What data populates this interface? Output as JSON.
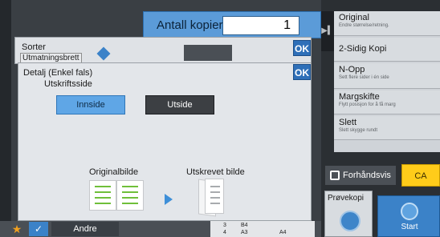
{
  "copies": {
    "label": "Antall kopier",
    "value": "1"
  },
  "right_panel": {
    "items": [
      {
        "title": "Original",
        "subtitle": "Endre størrelse/retning."
      },
      {
        "title": "2-Sidig Kopi",
        "subtitle": ""
      },
      {
        "title": "N-Opp",
        "subtitle": "Sett flere sider i én side"
      },
      {
        "title": "Margskifte",
        "subtitle": "Flytt posisjon for å få marg"
      },
      {
        "title": "Slett",
        "subtitle": "Slett skygge rundt"
      }
    ]
  },
  "actions": {
    "preview": "Forhåndsvis",
    "ca": "CA",
    "proof": "Prøvekopi",
    "start": "Start"
  },
  "bottom_bar": {
    "andre": "Andre",
    "tray": {
      "row1_num": "3",
      "row1_size": "B4",
      "row2_num": "4",
      "row2_size": "A3",
      "size": "A4"
    }
  },
  "dialog_sorter": {
    "title": "Sorter",
    "subtitle": "Utmatningsbrett",
    "ok": "OK"
  },
  "dialog_detail": {
    "title": "Detalj (Enkel fals)",
    "subtitle": "Utskriftsside",
    "ok": "OK",
    "options": [
      {
        "label": "Innside",
        "selected": true
      },
      {
        "label": "Utside",
        "selected": false
      }
    ],
    "original_label": "Originalbilde",
    "output_label": "Utskrevet bilde"
  },
  "colors": {
    "accent": "#2e6fb8",
    "selected": "#5fa6e6",
    "page_lines": "#6fbf3a",
    "ca": "#ffcc1a"
  }
}
